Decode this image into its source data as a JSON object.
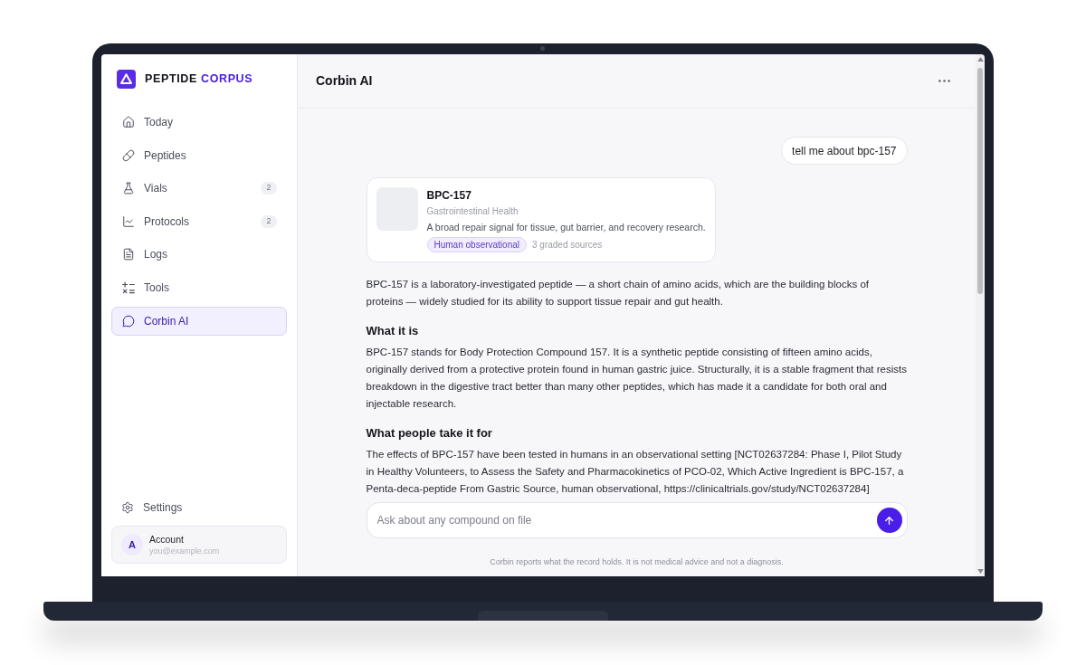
{
  "sidebar": {
    "brand": {
      "name": "PEPTIDE",
      "accent": "CORPUS"
    },
    "nav": [
      {
        "label": "Today",
        "selected": false
      },
      {
        "label": "Peptides",
        "selected": false
      },
      {
        "label": "Vials",
        "badge": "2",
        "selected": false
      },
      {
        "label": "Protocols",
        "badge": "2",
        "selected": false
      },
      {
        "label": "Logs",
        "selected": false
      },
      {
        "label": "Tools",
        "selected": false
      },
      {
        "label": "Corbin AI",
        "selected": true
      }
    ],
    "settings": {
      "label": "Settings"
    },
    "account": {
      "avatar": "A",
      "name": "Account",
      "email": "you@example.com"
    }
  },
  "header": {
    "title": "Corbin AI"
  },
  "chat": {
    "messages": [
      {
        "kind": "user",
        "text": "tell me about bpc-157"
      },
      {
        "kind": "compound_card",
        "title": "BPC-157",
        "category": "Gastrointestinal Health",
        "summary": "A broad repair signal for tissue, gut barrier, and recovery research.",
        "tag": "Human observational",
        "sources": "3 graded sources"
      },
      {
        "kind": "paragraph",
        "text": "BPC-157 is a laboratory-investigated peptide — a short chain of amino acids, which are the building blocks of proteins — widely studied for its ability to support tissue repair and gut health."
      },
      {
        "kind": "heading",
        "text": "What it is"
      },
      {
        "kind": "paragraph",
        "text": "BPC-157 stands for Body Protection Compound 157. It is a synthetic peptide consisting of fifteen amino acids, originally derived from a protective protein found in human gastric juice. Structurally, it is a stable fragment that resists breakdown in the digestive tract better than many other peptides, which has made it a candidate for both oral and injectable research."
      },
      {
        "kind": "heading",
        "text": "What people take it for"
      },
      {
        "kind": "paragraph",
        "text": "The effects of BPC-157 have been tested in humans in an observational setting [NCT02637284: Phase I, Pilot Study in Healthy Volunteers, to Assess the Safety and Pharmacokinetics of PCO-02, Which Active Ingredient is BPC-157, a Penta-deca-peptide From Gastric Source, human observational, https://clinicaltrials.gov/study/NCT02637284]"
      }
    ]
  },
  "composer": {
    "placeholder": "Ask about any compound on file",
    "disclaimer": "Corbin reports what the record holds. It is not medical advice and not a diagnosis."
  }
}
